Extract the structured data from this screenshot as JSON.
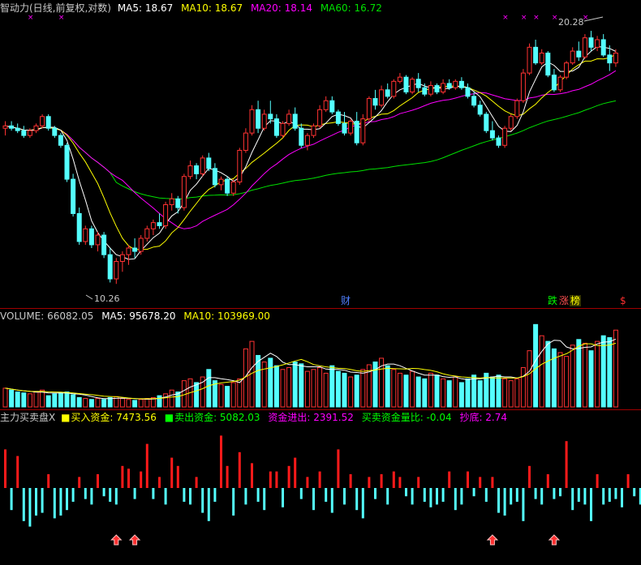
{
  "price_panel": {
    "title": "智动力(日线,前复权,对数)",
    "ma5_label": "MA5: 18.67",
    "ma10_label": "MA10: 18.67",
    "ma20_label": "MA20: 18.14",
    "ma60_label": "MA60: 16.72",
    "high_annotation": "20.28",
    "low_annotation": "10.26",
    "colors": {
      "title": "#c8c8c8",
      "ma5": "#ffffff",
      "ma10": "#ffff00",
      "ma20": "#ff00ff",
      "ma60": "#00e000",
      "up": "#ff3232",
      "down": "#54ffff",
      "marker": "#ff00ff"
    }
  },
  "event_markers": [
    {
      "label": "财",
      "color": "#4f7fff"
    },
    {
      "label": "跌",
      "color": "#00ff00"
    },
    {
      "label": "涨",
      "color": "#ff5050"
    },
    {
      "label": "榜",
      "color": "#ffff00"
    },
    {
      "label": "$",
      "color": "#ff3030"
    }
  ],
  "volume_panel": {
    "label": "VOLUME: 66082.05",
    "ma5_label": "MA5: 95678.20",
    "ma10_label": "MA10: 103969.00"
  },
  "indicator_panel": {
    "title": "主力买卖盘X",
    "buy_label": "买入资金: 7473.56",
    "sell_label": "卖出资金: 5082.03",
    "net_label": "资金进出: 2391.52",
    "ratio_label": "买卖资金量比: -0.04",
    "bottom_label": "抄底: 2.74",
    "bottom_signal_icon": "red-up-arrow-icon"
  },
  "chart_data": {
    "type": "candlestick",
    "y_scale": "log",
    "ylim": [
      10,
      21
    ],
    "high_mark": 20.28,
    "low_mark": 10.26,
    "ma_last": {
      "MA5": 18.67,
      "MA10": 18.67,
      "MA20": 18.14,
      "MA60": 16.72
    },
    "ohlc": [
      [
        15.6,
        15.9,
        15.3,
        15.7
      ],
      [
        15.7,
        15.9,
        15.5,
        15.6
      ],
      [
        15.6,
        15.8,
        15.4,
        15.5
      ],
      [
        15.5,
        15.7,
        15.2,
        15.3
      ],
      [
        15.3,
        15.6,
        15.2,
        15.5
      ],
      [
        15.5,
        15.8,
        15.4,
        15.7
      ],
      [
        15.7,
        16.2,
        15.6,
        16.1
      ],
      [
        16.1,
        16.2,
        15.5,
        15.6
      ],
      [
        15.6,
        15.7,
        15.2,
        15.3
      ],
      [
        15.3,
        15.4,
        14.8,
        14.9
      ],
      [
        14.9,
        15.0,
        13.5,
        13.6
      ],
      [
        13.6,
        13.8,
        12.3,
        12.4
      ],
      [
        12.4,
        12.6,
        11.4,
        11.5
      ],
      [
        11.5,
        12.0,
        11.4,
        11.9
      ],
      [
        11.9,
        12.0,
        11.3,
        11.4
      ],
      [
        11.4,
        11.8,
        11.2,
        11.7
      ],
      [
        11.7,
        11.8,
        11.0,
        11.1
      ],
      [
        11.1,
        11.3,
        10.3,
        10.4
      ],
      [
        10.4,
        11.0,
        10.26,
        10.9
      ],
      [
        10.9,
        11.2,
        10.6,
        11.1
      ],
      [
        11.1,
        11.4,
        10.8,
        11.3
      ],
      [
        11.3,
        11.6,
        11.0,
        11.2
      ],
      [
        11.2,
        11.7,
        11.1,
        11.6
      ],
      [
        11.6,
        12.0,
        11.5,
        11.9
      ],
      [
        11.9,
        12.2,
        11.7,
        12.1
      ],
      [
        12.1,
        12.4,
        11.9,
        12.0
      ],
      [
        12.0,
        12.8,
        11.9,
        12.7
      ],
      [
        12.7,
        13.1,
        12.5,
        12.9
      ],
      [
        12.9,
        13.0,
        12.4,
        12.6
      ],
      [
        12.6,
        13.8,
        12.5,
        13.7
      ],
      [
        13.7,
        14.3,
        13.6,
        14.1
      ],
      [
        14.1,
        14.2,
        13.6,
        13.8
      ],
      [
        13.8,
        14.5,
        13.7,
        14.4
      ],
      [
        14.4,
        14.6,
        13.9,
        14.0
      ],
      [
        14.0,
        14.2,
        13.3,
        13.4
      ],
      [
        13.4,
        13.7,
        13.2,
        13.6
      ],
      [
        13.6,
        13.7,
        13.0,
        13.1
      ],
      [
        13.1,
        13.6,
        13.0,
        13.5
      ],
      [
        13.5,
        14.8,
        13.4,
        14.7
      ],
      [
        14.7,
        15.6,
        14.6,
        15.4
      ],
      [
        15.4,
        16.6,
        15.3,
        16.4
      ],
      [
        16.4,
        16.8,
        15.4,
        15.6
      ],
      [
        15.6,
        16.4,
        15.5,
        16.2
      ],
      [
        16.2,
        16.8,
        15.8,
        16.0
      ],
      [
        16.0,
        16.2,
        15.2,
        15.3
      ],
      [
        15.3,
        15.9,
        15.2,
        15.8
      ],
      [
        15.8,
        16.4,
        15.7,
        16.2
      ],
      [
        16.2,
        16.5,
        15.5,
        15.6
      ],
      [
        15.6,
        15.8,
        14.8,
        14.9
      ],
      [
        14.9,
        15.4,
        14.7,
        15.3
      ],
      [
        15.3,
        15.8,
        15.2,
        15.7
      ],
      [
        15.7,
        16.6,
        15.6,
        16.4
      ],
      [
        16.4,
        17.0,
        16.3,
        16.8
      ],
      [
        16.8,
        17.0,
        16.2,
        16.3
      ],
      [
        16.3,
        16.4,
        15.7,
        15.8
      ],
      [
        15.8,
        16.3,
        15.3,
        15.4
      ],
      [
        15.4,
        16.0,
        15.3,
        15.9
      ],
      [
        15.9,
        16.3,
        14.9,
        15.0
      ],
      [
        15.0,
        16.2,
        14.9,
        16.0
      ],
      [
        16.0,
        17.0,
        15.9,
        16.9
      ],
      [
        16.9,
        17.3,
        16.4,
        16.6
      ],
      [
        16.6,
        17.5,
        16.5,
        17.3
      ],
      [
        17.3,
        17.6,
        16.9,
        17.0
      ],
      [
        17.0,
        17.8,
        16.9,
        17.7
      ],
      [
        17.7,
        18.1,
        17.6,
        17.9
      ],
      [
        17.9,
        18.0,
        17.1,
        17.2
      ],
      [
        17.2,
        17.9,
        17.1,
        17.8
      ],
      [
        17.8,
        18.1,
        17.2,
        17.4
      ],
      [
        17.4,
        17.6,
        17.0,
        17.1
      ],
      [
        17.1,
        17.7,
        17.0,
        17.5
      ],
      [
        17.5,
        17.6,
        17.1,
        17.2
      ],
      [
        17.2,
        17.8,
        17.1,
        17.6
      ],
      [
        17.6,
        17.8,
        17.3,
        17.4
      ],
      [
        17.4,
        17.8,
        17.3,
        17.7
      ],
      [
        17.7,
        17.9,
        17.3,
        17.4
      ],
      [
        17.4,
        17.6,
        16.9,
        17.0
      ],
      [
        17.0,
        17.2,
        16.5,
        16.6
      ],
      [
        16.6,
        16.8,
        16.1,
        16.2
      ],
      [
        16.2,
        16.3,
        15.4,
        15.5
      ],
      [
        15.5,
        15.9,
        15.1,
        15.2
      ],
      [
        15.2,
        15.3,
        14.8,
        14.9
      ],
      [
        14.9,
        15.7,
        14.8,
        15.6
      ],
      [
        15.6,
        16.2,
        15.5,
        16.1
      ],
      [
        16.1,
        16.9,
        16.0,
        16.8
      ],
      [
        16.8,
        18.3,
        16.7,
        18.1
      ],
      [
        18.1,
        19.6,
        18.0,
        19.4
      ],
      [
        19.4,
        19.8,
        18.5,
        18.6
      ],
      [
        18.6,
        19.3,
        18.5,
        19.1
      ],
      [
        19.1,
        19.2,
        17.9,
        18.0
      ],
      [
        18.0,
        18.3,
        17.2,
        17.3
      ],
      [
        17.3,
        18.0,
        17.2,
        17.9
      ],
      [
        17.9,
        18.7,
        17.8,
        18.6
      ],
      [
        18.6,
        19.4,
        18.5,
        19.2
      ],
      [
        19.2,
        19.7,
        18.7,
        18.9
      ],
      [
        18.9,
        20.1,
        18.8,
        19.9
      ],
      [
        19.9,
        20.28,
        19.2,
        19.4
      ],
      [
        19.4,
        20.0,
        19.2,
        19.8
      ],
      [
        19.8,
        20.1,
        18.9,
        19.0
      ],
      [
        19.0,
        19.5,
        18.2,
        18.6
      ],
      [
        18.6,
        19.3,
        18.4,
        19.1
      ]
    ],
    "volume": [
      20,
      18,
      16,
      15,
      14,
      16,
      18,
      12,
      14,
      15,
      16,
      13,
      10,
      9,
      8,
      9,
      8,
      10,
      11,
      9,
      8,
      7,
      8,
      9,
      10,
      12,
      14,
      18,
      16,
      28,
      30,
      26,
      32,
      40,
      28,
      24,
      22,
      26,
      30,
      62,
      70,
      55,
      48,
      52,
      44,
      40,
      42,
      48,
      46,
      38,
      40,
      42,
      36,
      44,
      38,
      36,
      32,
      34,
      40,
      45,
      48,
      52,
      44,
      40,
      36,
      34,
      38,
      32,
      30,
      36,
      34,
      30,
      28,
      32,
      26,
      30,
      34,
      28,
      36,
      32,
      34,
      30,
      28,
      30,
      42,
      60,
      88,
      76,
      70,
      62,
      58,
      54,
      66,
      72,
      68,
      60,
      70,
      76,
      74,
      82
    ],
    "flow": [
      70,
      -40,
      58,
      -60,
      -70,
      -50,
      -45,
      25,
      -55,
      -50,
      -40,
      -25,
      20,
      -20,
      -30,
      25,
      -15,
      -25,
      -30,
      40,
      35,
      -20,
      30,
      80,
      -20,
      20,
      -30,
      55,
      40,
      -25,
      -30,
      20,
      -45,
      -60,
      -25,
      95,
      40,
      -50,
      65,
      -30,
      45,
      -25,
      -40,
      30,
      30,
      -35,
      40,
      55,
      -20,
      20,
      -40,
      30,
      -25,
      -45,
      70,
      -30,
      25,
      -40,
      -55,
      20,
      -20,
      25,
      -30,
      30,
      20,
      -15,
      -30,
      20,
      -25,
      -35,
      -30,
      -25,
      30,
      -40,
      -30,
      30,
      -15,
      20,
      -25,
      20,
      -45,
      -50,
      -30,
      -25,
      -60,
      40,
      -20,
      -30,
      25,
      -20,
      -15,
      85,
      -40,
      -25,
      -30,
      -60,
      25,
      -30,
      -25,
      -20,
      -35,
      25,
      -15,
      -30,
      -20
    ],
    "bottom_signals": [
      18,
      21,
      79,
      89
    ]
  }
}
